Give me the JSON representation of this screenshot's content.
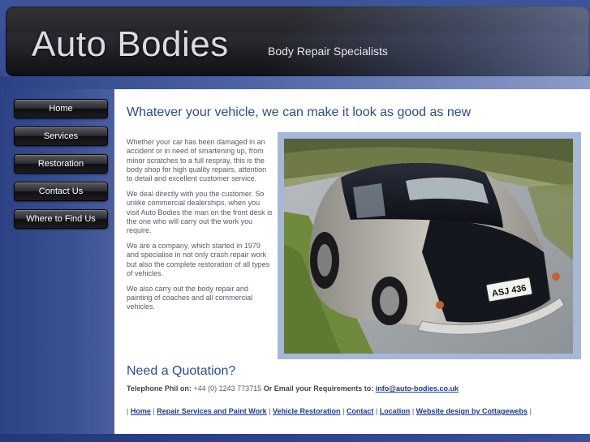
{
  "header": {
    "title": "Auto Bodies",
    "subtitle": "Body Repair Specialists"
  },
  "nav": {
    "items": [
      "Home",
      "Services",
      "Restoration",
      "Contact Us",
      "Where to Find Us"
    ]
  },
  "main": {
    "headline": "Whatever your vehicle, we can make it look as good as new",
    "paragraphs": [
      "Whether your car has been damaged in an accident or in need of smartening up, from minor scratches to a full respray, this is the body shop for high quality repairs, attention to detail and excellent customer service.",
      "We deal directly with you the customer. So unlike commercial dealerships, when you visit Auto Bodies the man on the front desk is the one who will carry out the work you require.",
      "We are a company, which started in 1979 and specialise in not only crash repair work but also the complete restoration of all types of vehicles.",
      "We also carry out the body repair and painting of coaches and all commercial vehicles."
    ],
    "photo": {
      "plate": "ASJ 436"
    },
    "quotation": {
      "title": "Need a Quotation?",
      "phone_label": "Telephone Phil on:",
      "phone": "+44 (0) 1243 773715",
      "email_label": "Or Email your Requirements to:",
      "email": "info@auto-bodies.co.uk"
    },
    "footer_links": [
      "Home",
      "Repair Services and Paint Work",
      "Vehicle Restoration",
      "Contact",
      "Location",
      "Website design by Cottagewebs"
    ]
  },
  "colors": {
    "page_bg": "#2d4388",
    "header_bg": "#1b1b1d",
    "heading": "#2d4a8f",
    "link": "#1f3a8a",
    "body_text": "#555a66",
    "photo_frame": "#a7b7d8"
  }
}
